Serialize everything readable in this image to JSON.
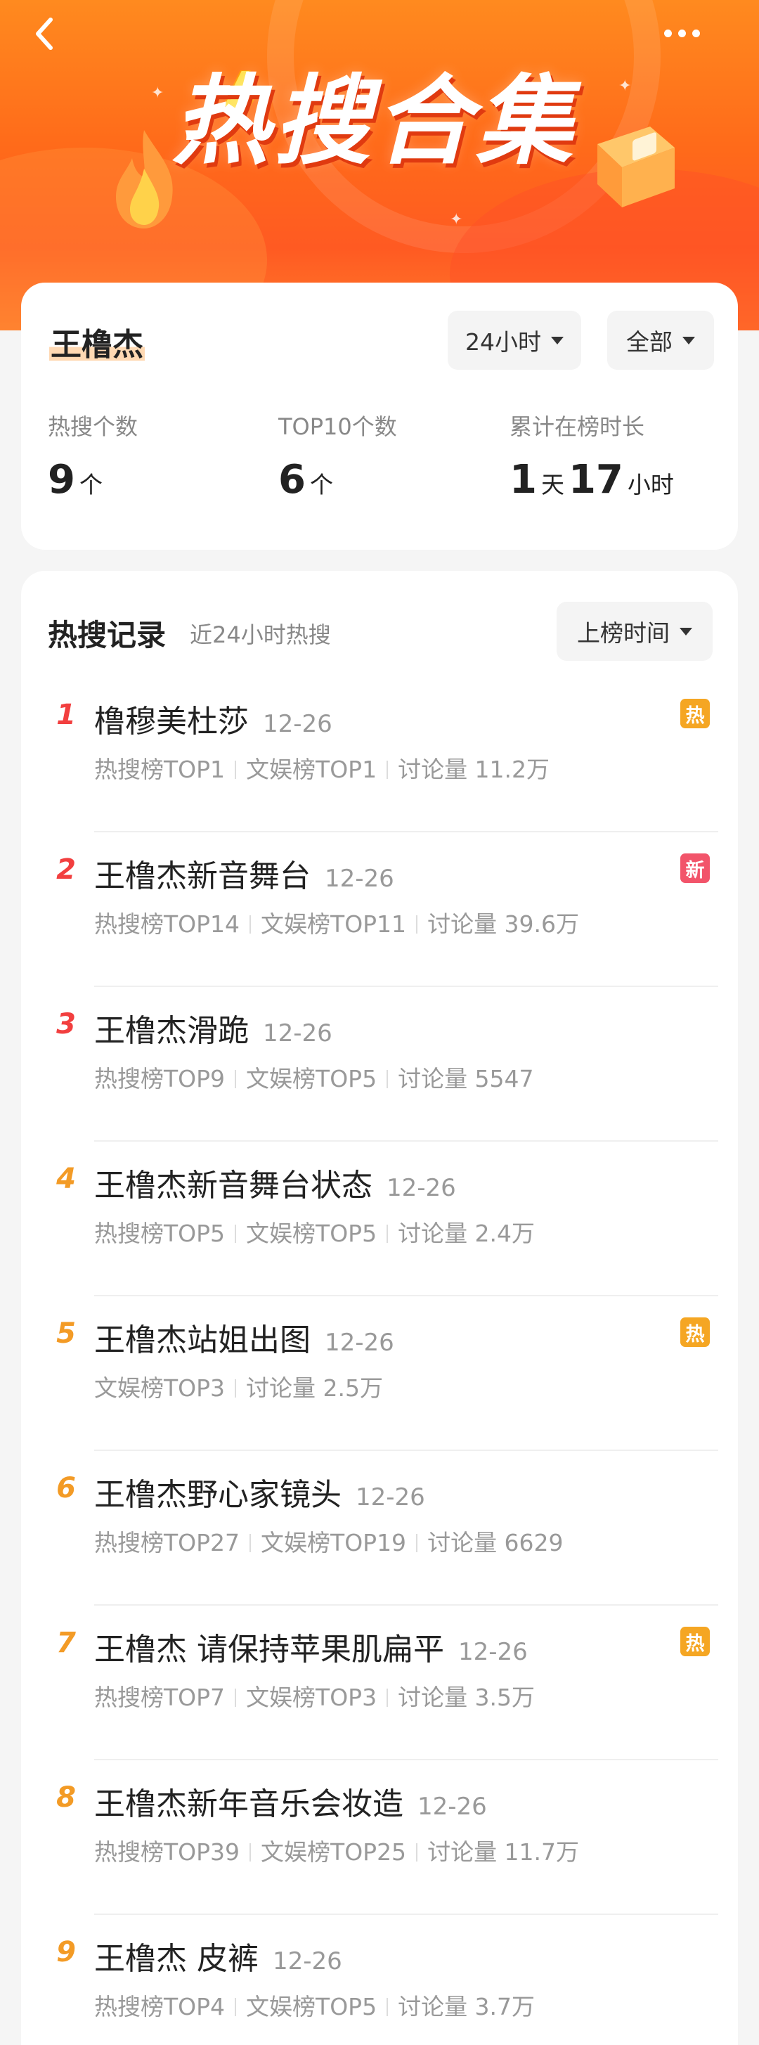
{
  "page": {
    "title": "热搜合集"
  },
  "colors": {
    "rank_top": "#f23f3f",
    "rank_other": "#f39b26",
    "badge_hot": "#f5a623",
    "badge_new": "#f2546a",
    "hero": "#ff6a1a"
  },
  "icons": {
    "back": "chevron-left-icon",
    "more": "more-dots-icon",
    "flame": "flame-icon",
    "bolt": "lightning-icon",
    "box": "gift-box-icon"
  },
  "summary": {
    "name": "王橹杰",
    "time_filter": "24小时",
    "scope_filter": "全部",
    "stats": [
      {
        "label": "热搜个数",
        "value": "9",
        "unit": "个"
      },
      {
        "label": "TOP10个数",
        "value": "6",
        "unit": "个"
      },
      {
        "label": "累计在榜时长",
        "days": "1",
        "days_unit": "天",
        "hours": "17",
        "hours_unit": "小时"
      }
    ]
  },
  "records": {
    "title": "热搜记录",
    "subtitle": "近24小时热搜",
    "sort": "上榜时间",
    "items": [
      {
        "rank": "1",
        "title": "橹穆美杜莎",
        "date": "12-26",
        "meta": [
          "热搜榜TOP1",
          "文娱榜TOP1",
          "讨论量 11.2万"
        ],
        "badge": "热",
        "badge_type": "hot"
      },
      {
        "rank": "2",
        "title": "王橹杰新音舞台",
        "date": "12-26",
        "meta": [
          "热搜榜TOP14",
          "文娱榜TOP11",
          "讨论量 39.6万"
        ],
        "badge": "新",
        "badge_type": "new"
      },
      {
        "rank": "3",
        "title": "王橹杰滑跪",
        "date": "12-26",
        "meta": [
          "热搜榜TOP9",
          "文娱榜TOP5",
          "讨论量 5547"
        ],
        "badge": "",
        "badge_type": ""
      },
      {
        "rank": "4",
        "title": "王橹杰新音舞台状态",
        "date": "12-26",
        "meta": [
          "热搜榜TOP5",
          "文娱榜TOP5",
          "讨论量 2.4万"
        ],
        "badge": "",
        "badge_type": ""
      },
      {
        "rank": "5",
        "title": "王橹杰站姐出图",
        "date": "12-26",
        "meta": [
          "文娱榜TOP3",
          "讨论量 2.5万"
        ],
        "badge": "热",
        "badge_type": "hot"
      },
      {
        "rank": "6",
        "title": "王橹杰野心家镜头",
        "date": "12-26",
        "meta": [
          "热搜榜TOP27",
          "文娱榜TOP19",
          "讨论量 6629"
        ],
        "badge": "",
        "badge_type": ""
      },
      {
        "rank": "7",
        "title": "王橹杰 请保持苹果肌扁平",
        "date": "12-26",
        "meta": [
          "热搜榜TOP7",
          "文娱榜TOP3",
          "讨论量 3.5万"
        ],
        "badge": "热",
        "badge_type": "hot"
      },
      {
        "rank": "8",
        "title": "王橹杰新年音乐会妆造",
        "date": "12-26",
        "meta": [
          "热搜榜TOP39",
          "文娱榜TOP25",
          "讨论量 11.7万"
        ],
        "badge": "",
        "badge_type": ""
      },
      {
        "rank": "9",
        "title": "王橹杰 皮裤",
        "date": "12-26",
        "meta": [
          "热搜榜TOP4",
          "文娱榜TOP5",
          "讨论量 3.7万"
        ],
        "badge": "",
        "badge_type": ""
      }
    ]
  }
}
